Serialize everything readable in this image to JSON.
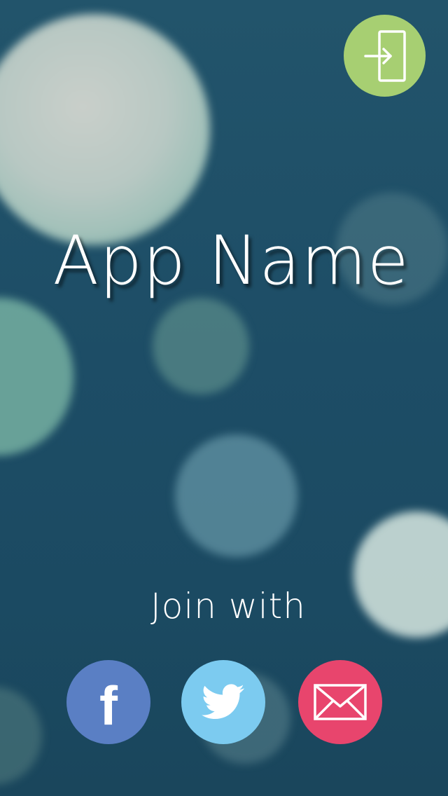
{
  "app": {
    "title": "App Name"
  },
  "header": {
    "signin_icon": "sign-in-icon"
  },
  "join": {
    "label": "Join with",
    "buttons": [
      {
        "id": "facebook",
        "glyph": "f",
        "icon": "facebook-icon",
        "color": "#5a7fc4"
      },
      {
        "id": "twitter",
        "icon": "twitter-bird-icon",
        "color": "#7ccbf0"
      },
      {
        "id": "email",
        "icon": "envelope-icon",
        "color": "#e8456d"
      }
    ]
  },
  "colors": {
    "signin_accent": "#a7cf72",
    "background": "#1d4d66"
  }
}
